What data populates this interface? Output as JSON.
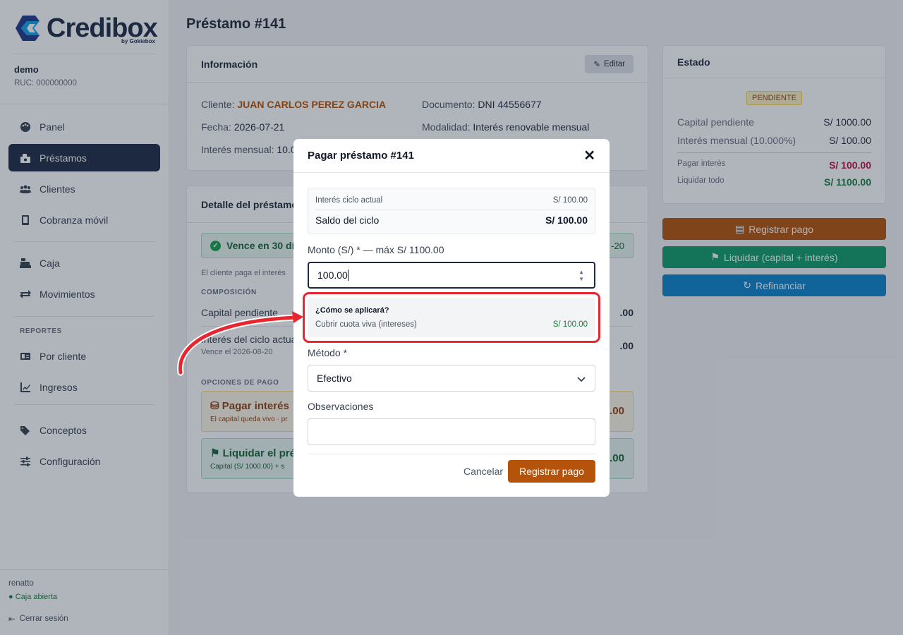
{
  "brand": {
    "name_prefix": "Credi",
    "name_suffix": "box",
    "sub": "by Gokiebox"
  },
  "company": {
    "name": "demo",
    "ruc": "RUC: 000000000"
  },
  "nav": {
    "items": [
      {
        "label": "Panel",
        "icon": "palette-icon"
      },
      {
        "label": "Préstamos",
        "icon": "money-icon",
        "active": true
      },
      {
        "label": "Clientes",
        "icon": "users-icon"
      },
      {
        "label": "Cobranza móvil",
        "icon": "mobile-icon"
      },
      {
        "label": "Caja",
        "icon": "cash-register-icon"
      },
      {
        "label": "Movimientos",
        "icon": "exchange-icon"
      }
    ],
    "reports_label": "REPORTES",
    "reports": [
      {
        "label": "Por cliente",
        "icon": "id-card-icon"
      },
      {
        "label": "Ingresos",
        "icon": "chart-line-icon"
      }
    ],
    "extra": [
      {
        "label": "Conceptos",
        "icon": "tags-icon"
      },
      {
        "label": "Configuración",
        "icon": "sliders-icon"
      }
    ]
  },
  "footer": {
    "user": "renatto",
    "caja": "● Caja abierta",
    "logout": "Cerrar sesión"
  },
  "page": {
    "title": "Préstamo #141"
  },
  "info": {
    "title": "Información",
    "edit": "Editar",
    "cliente_label": "Cliente:",
    "cliente": "JUAN CARLOS PEREZ GARCIA",
    "documento_label": "Documento:",
    "documento": "DNI 44556677",
    "fecha_label": "Fecha:",
    "fecha": "2026-07-21",
    "modalidad_label": "Modalidad:",
    "modalidad": "Interés renovable mensual",
    "interes_label": "Interés mensual:",
    "interes": "10.0"
  },
  "detalle": {
    "title": "Detalle del préstamo",
    "banner": "Vence en 30 días",
    "banner_right": "-20",
    "note": "El cliente paga el interés",
    "composicion": "COMPOSICIÓN",
    "capital_label": "Capital pendiente",
    "capital_amt": ".00",
    "interes_label": "Interés del ciclo actual",
    "interes_amt": ".00",
    "vence": "Vence el 2026-08-20",
    "opciones": "OPCIONES DE PAGO",
    "opt1_title": "Pagar interés",
    "opt1_sub": "El capital queda vivo · pr",
    "opt1_amt": ".00",
    "opt2_title": "Liquidar el pré",
    "opt2_sub": "Capital (S/ 1000.00) + s",
    "opt2_amt": ".00"
  },
  "estado": {
    "title": "Estado",
    "badge": "PENDIENTE",
    "rows": [
      {
        "label": "Capital pendiente",
        "value": "S/ 1000.00"
      },
      {
        "label": "Interés mensual (10.000%)",
        "value": "S/ 100.00"
      }
    ],
    "pagar_label": "Pagar interés",
    "pagar_value": "S/ 100.00",
    "liquidar_label": "Liquidar todo",
    "liquidar_value": "S/ 1100.00",
    "colors": {
      "pagar": "#be123c",
      "liquidar": "#15803d"
    }
  },
  "actions": {
    "registrar": "Registrar pago",
    "liquidar": "Liquidar (capital + interés)",
    "refinanciar": "Refinanciar",
    "colors": {
      "registrar": "#b45309",
      "liquidar": "#0f9d6b",
      "refinanciar": "#0a84cc"
    }
  },
  "modal": {
    "title": "Pagar préstamo #141",
    "summary_label": "Interés ciclo actual",
    "summary_value": "S/ 100.00",
    "saldo_label": "Saldo del ciclo",
    "saldo_value": "S/ 100.00",
    "monto_label": "Monto (S/) * — máx S/ 1100.00",
    "monto_value": "100.00",
    "apply_title": "¿Cómo se aplicará?",
    "apply_label": "Cubrir cuota viva (intereses)",
    "apply_value": "S/ 100.00",
    "metodo_label": "Método *",
    "metodo_value": "Efectivo",
    "obs_label": "Observaciones",
    "obs_value": "",
    "cancel": "Cancelar",
    "submit": "Registrar pago"
  }
}
